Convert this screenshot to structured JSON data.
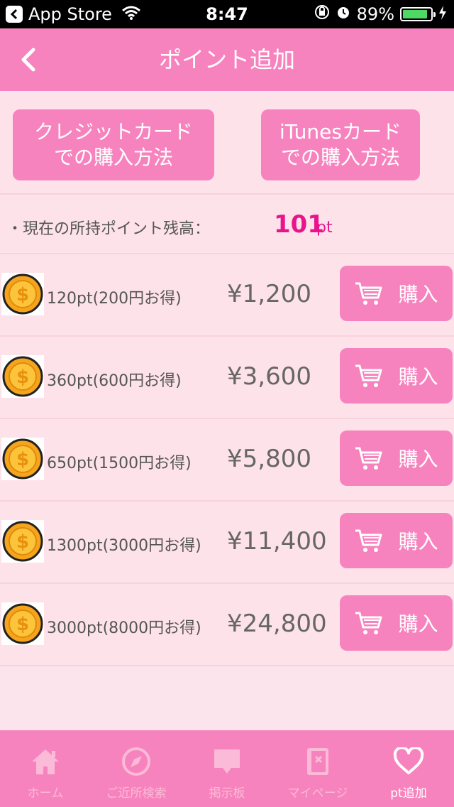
{
  "status_bar": {
    "back_app": "App Store",
    "time": "8:47",
    "battery": "89%",
    "battery_level": 0.89
  },
  "nav": {
    "title": "ポイント追加"
  },
  "methods": {
    "credit_card_line1": "クレジットカード",
    "credit_card_line2": "での購入方法",
    "itunes_line1": "iTunesカード",
    "itunes_line2": "での購入方法"
  },
  "balance": {
    "label": "・現在の所持ポイント残高：",
    "value": "101",
    "unit": "pt"
  },
  "items": [
    {
      "label": "120pt(200円お得)",
      "price": "¥1,200",
      "buy": "購入"
    },
    {
      "label": "360pt(600円お得)",
      "price": "¥3,600",
      "buy": "購入"
    },
    {
      "label": "650pt(1500円お得)",
      "price": "¥5,800",
      "buy": "購入"
    },
    {
      "label": "1300pt(3000円お得)",
      "price": "¥11,400",
      "buy": "購入"
    },
    {
      "label": "3000pt(8000円お得)",
      "price": "¥24,800",
      "buy": "購入"
    }
  ],
  "tabs": [
    {
      "label": "ホーム",
      "icon": "home-icon"
    },
    {
      "label": "ご近所検索",
      "icon": "compass-icon"
    },
    {
      "label": "掲示板",
      "icon": "speech-bubble-icon"
    },
    {
      "label": "マイページ",
      "icon": "notebook-icon"
    },
    {
      "label": "pt追加",
      "icon": "heart-icon"
    }
  ],
  "colors": {
    "accent": "#f783be",
    "background": "#fde2ea",
    "balance_value": "#e9148c",
    "tab_inactive": "#fbbad7"
  }
}
